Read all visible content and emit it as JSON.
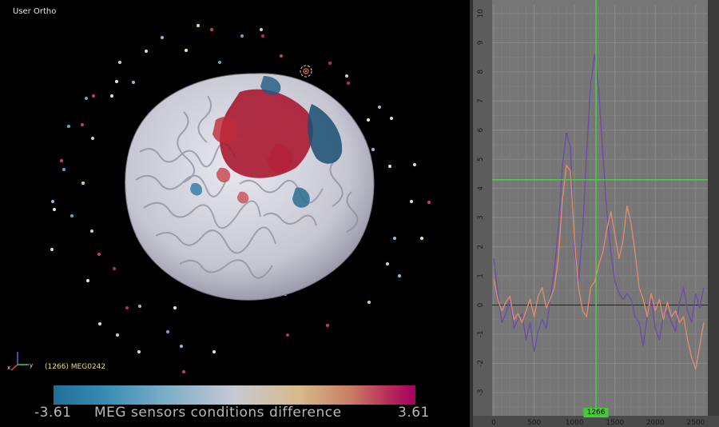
{
  "viewport": {
    "view_label": "User Ortho",
    "object_label": "(1266) MEG0242",
    "axis_x": "x",
    "axis_y": "y"
  },
  "colorbar": {
    "min_label": "-3.61",
    "max_label": "3.61",
    "title": "MEG sensors conditions difference",
    "colors": [
      "#1f6e97",
      "#c8c9d4",
      "#a6005e"
    ]
  },
  "graph": {
    "current_frame": "1266",
    "cursor_value": 4.3,
    "x_ticks": [
      "0",
      "500",
      "1000",
      "1500",
      "2000",
      "2500"
    ],
    "y_ticks": [
      "-3",
      "-2",
      "-1",
      "0",
      "1",
      "2",
      "3",
      "4",
      "5",
      "6",
      "7",
      "8",
      "9",
      "10"
    ],
    "series_colors": [
      "#6b4ba8",
      "#e58c6c"
    ]
  },
  "chart_data": {
    "type": "line",
    "title": "",
    "xlabel": "",
    "ylabel": "",
    "xlim": [
      -20,
      2650
    ],
    "ylim": [
      -3.8,
      10.3
    ],
    "x": [
      0,
      50,
      100,
      150,
      200,
      250,
      300,
      350,
      400,
      450,
      500,
      550,
      600,
      650,
      700,
      750,
      800,
      850,
      900,
      950,
      1000,
      1050,
      1100,
      1150,
      1200,
      1250,
      1300,
      1350,
      1400,
      1450,
      1500,
      1550,
      1600,
      1650,
      1700,
      1750,
      1800,
      1850,
      1900,
      1950,
      2000,
      2050,
      2100,
      2150,
      2200,
      2250,
      2300,
      2350,
      2400,
      2450,
      2500,
      2550,
      2600
    ],
    "series": [
      {
        "values": [
          1.6,
          0.4,
          -0.6,
          -0.3,
          0.2,
          -0.8,
          -0.5,
          -0.3,
          -1.2,
          -0.6,
          -1.6,
          -0.9,
          -0.5,
          -0.8,
          0.2,
          1.2,
          2.6,
          4.8,
          5.9,
          5.4,
          1.8,
          0.8,
          2.6,
          5.2,
          7.6,
          8.6,
          7.4,
          5.2,
          3.2,
          1.8,
          0.8,
          0.4,
          0.2,
          0.4,
          0.2,
          -0.4,
          -0.6,
          -1.4,
          -0.4,
          0.2,
          -0.8,
          -1.2,
          -0.4,
          -0.2,
          -0.6,
          -0.9,
          0.1,
          0.6,
          -0.2,
          -0.6,
          0.4,
          -0.1,
          0.6
        ]
      },
      {
        "values": [
          0.9,
          0.2,
          -0.2,
          0.1,
          0.3,
          -0.5,
          -0.3,
          -0.6,
          -0.2,
          0.2,
          -0.4,
          0.3,
          0.6,
          -0.1,
          0.2,
          0.6,
          1.6,
          3.6,
          4.8,
          4.6,
          2.2,
          0.6,
          -0.2,
          -0.4,
          0.6,
          0.8,
          1.4,
          1.8,
          2.6,
          3.2,
          2.4,
          1.6,
          2.2,
          3.4,
          2.8,
          1.8,
          0.6,
          0.2,
          -0.4,
          0.4,
          -0.2,
          0.2,
          -0.5,
          0.1,
          -0.4,
          -0.2,
          -0.6,
          -0.4,
          -1.2,
          -1.8,
          -2.2,
          -1.4,
          -0.6
        ]
      }
    ]
  }
}
